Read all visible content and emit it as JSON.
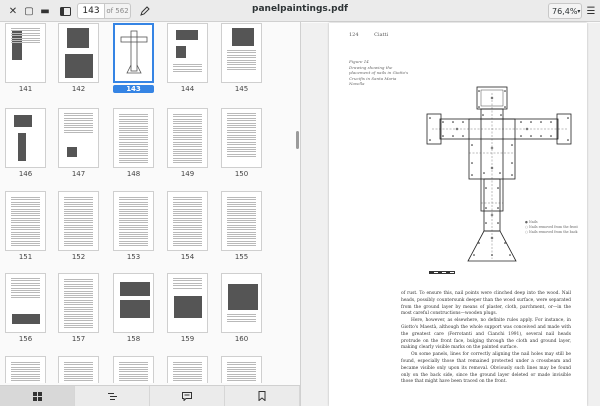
{
  "app": {
    "title": "panelpaintings.pdf",
    "page_current": "143",
    "page_total": "of 562",
    "zoom": "76,4%"
  },
  "thumbnails": [
    {
      "label": "141"
    },
    {
      "label": "142"
    },
    {
      "label": "143",
      "selected": true
    },
    {
      "label": "144"
    },
    {
      "label": "145"
    },
    {
      "label": "146"
    },
    {
      "label": "147"
    },
    {
      "label": "148"
    },
    {
      "label": "149"
    },
    {
      "label": "150"
    },
    {
      "label": "151"
    },
    {
      "label": "152"
    },
    {
      "label": "153"
    },
    {
      "label": "154"
    },
    {
      "label": "155"
    },
    {
      "label": "156"
    },
    {
      "label": "157"
    },
    {
      "label": "158"
    },
    {
      "label": "159"
    },
    {
      "label": "160"
    },
    {
      "label": ""
    },
    {
      "label": ""
    },
    {
      "label": ""
    },
    {
      "label": ""
    },
    {
      "label": ""
    }
  ],
  "bottom_tabs": [
    {
      "icon": "thumbnails-grid-icon",
      "active": true
    },
    {
      "icon": "outline-icon"
    },
    {
      "icon": "annotations-icon"
    },
    {
      "icon": "bookmarks-icon"
    }
  ],
  "document": {
    "page_number": "124",
    "running_head": "Ciatti",
    "figure_caption": "Figure 14\nDrawing showing the placement of nails in Giotto's Crucifix in Santa Maria Novella",
    "legend_line_1": "● Nails",
    "legend_line_2": "○ Nails removed from the front",
    "legend_line_3": "○ Nails removed from the back",
    "paragraphs": [
      "of rust. To ensure this, nail points were clinched deep into the wood. Nail heads, possibly countersunk deeper than the wood surface, were separated from the ground layer by means of plaster, cloth, parchment, or—in the most careful constructions—wooden plugs.",
      "Here, however, as elsewhere, no definite rules apply. For instance, in Giotto's Maestà, although the whole support was conceived and made with the greatest care (Ferrotanti and Cianchi 1991), several nail heads protrude on the front face, bulging through the cloth and ground layer, making clearly visible marks on the painted surface.",
      "On some panels, lines for correctly aligning the nail holes may still be found, especially those that remained protected under a crossbeam and became visible only upon its removal. Obviously such lines may be found only on the back side, since the ground layer deleted or made invisible those that might have been traced on the front."
    ]
  }
}
